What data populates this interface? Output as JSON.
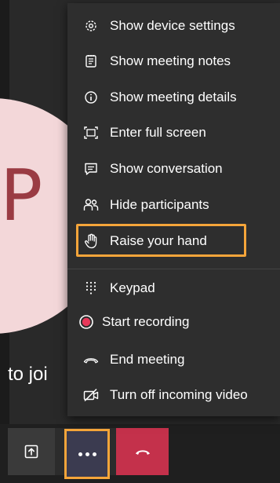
{
  "video": {
    "avatar_initial": "P",
    "join_text": "to joi"
  },
  "menu": {
    "items": [
      {
        "label": "Show device settings",
        "icon": "gear-icon"
      },
      {
        "label": "Show meeting notes",
        "icon": "notes-icon"
      },
      {
        "label": "Show meeting details",
        "icon": "info-icon"
      },
      {
        "label": "Enter full screen",
        "icon": "fullscreen-icon"
      },
      {
        "label": "Show conversation",
        "icon": "chat-icon"
      },
      {
        "label": "Hide participants",
        "icon": "participants-icon"
      },
      {
        "label": "Raise your hand",
        "icon": "hand-icon",
        "highlighted": true
      },
      {
        "label": "Keypad",
        "icon": "keypad-icon"
      },
      {
        "label": "Start recording",
        "icon": "record-icon"
      },
      {
        "label": "End meeting",
        "icon": "end-call-icon"
      },
      {
        "label": "Turn off incoming video",
        "icon": "video-off-icon"
      }
    ]
  },
  "toolbar": {
    "buttons": [
      {
        "name": "share",
        "icon": "share-screen-icon"
      },
      {
        "name": "more",
        "icon": "more-icon",
        "highlighted": true
      },
      {
        "name": "hangup",
        "icon": "hang-up-icon"
      }
    ]
  },
  "colors": {
    "highlight": "#f5a53a",
    "hangup": "#c4314b",
    "record": "#e8385a",
    "avatar_bg": "#f3d7d9",
    "avatar_fg": "#9a3b43"
  }
}
